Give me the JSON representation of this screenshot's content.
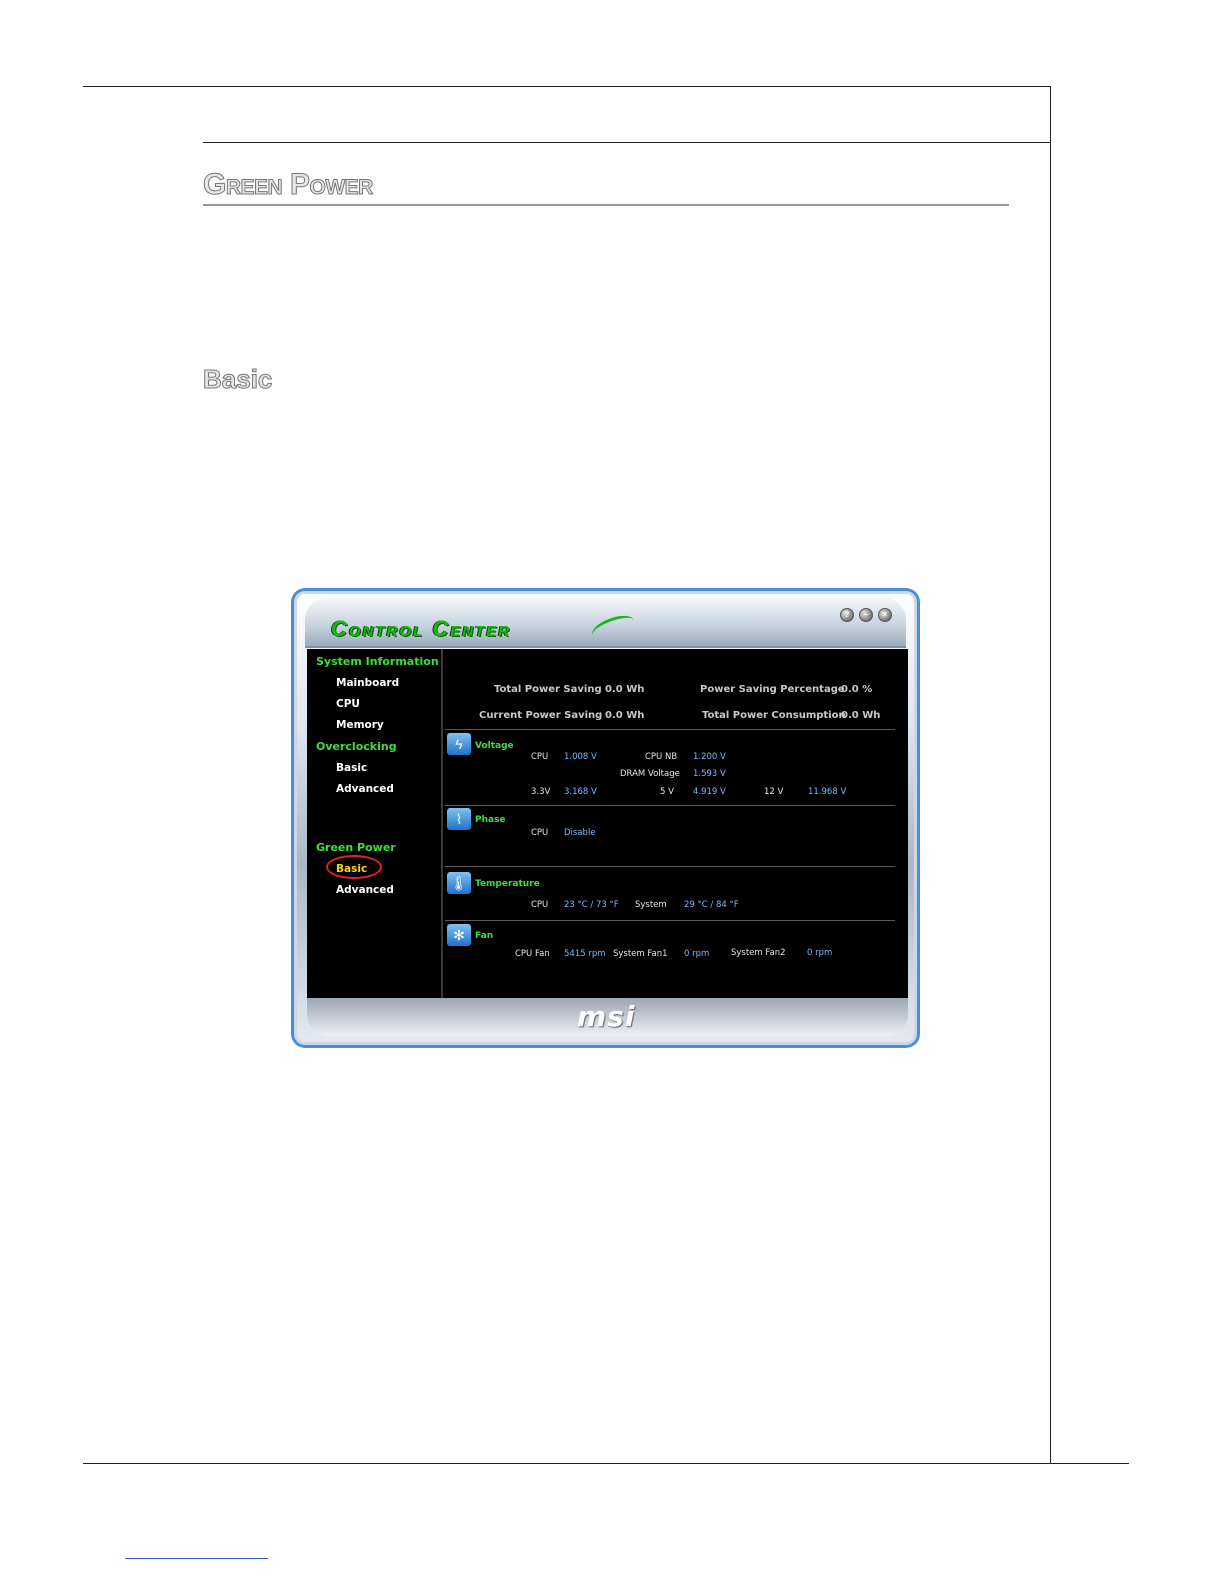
{
  "page": {
    "section_title": "Green Power",
    "sub_title": "Basic"
  },
  "app": {
    "logo": "Control Center",
    "brand": "msi",
    "window_buttons": [
      {
        "icon": "help-icon",
        "glyph": "?"
      },
      {
        "icon": "minimize-icon",
        "glyph": "–"
      },
      {
        "icon": "close-icon",
        "glyph": "×"
      }
    ],
    "sidebar": {
      "system_information": "System Information",
      "mainboard": "Mainboard",
      "cpu": "CPU",
      "memory": "Memory",
      "overclocking": "Overclocking",
      "oc_basic": "Basic",
      "oc_advanced": "Advanced",
      "green_power": "Green Power",
      "gp_basic": "Basic",
      "gp_advanced": "Advanced"
    },
    "summary": {
      "total_power_saving_label": "Total Power Saving",
      "total_power_saving_value": "0.0 Wh",
      "current_power_saving_label": "Current Power Saving",
      "current_power_saving_value": "0.0 Wh",
      "power_saving_percentage_label": "Power Saving Percentage",
      "power_saving_percentage_value": "0.0 %",
      "total_power_consumption_label": "Total Power Consumption",
      "total_power_consumption_value": "0.0 Wh"
    },
    "voltage": {
      "title": "Voltage",
      "cpu_label": "CPU",
      "cpu_value": "1.008 V",
      "cpunb_label": "CPU NB",
      "cpunb_value": "1.200 V",
      "dram_label": "DRAM Voltage",
      "dram_value": "1.593 V",
      "v33_label": "3.3V",
      "v33_value": "3.168 V",
      "v5_label": "5 V",
      "v5_value": "4.919 V",
      "v12_label": "12 V",
      "v12_value": "11.968 V"
    },
    "phase": {
      "title": "Phase",
      "cpu_label": "CPU",
      "cpu_value": "Disable"
    },
    "temperature": {
      "title": "Temperature",
      "cpu_label": "CPU",
      "cpu_value": "23 °C / 73 °F",
      "system_label": "System",
      "system_value": "29 °C / 84 °F"
    },
    "fan": {
      "title": "Fan",
      "cpu_fan_label": "CPU Fan",
      "cpu_fan_value": "5415 rpm",
      "sys_fan1_label": "System Fan1",
      "sys_fan1_value": "0 rpm",
      "sys_fan2_label": "System Fan2",
      "sys_fan2_value": "0 rpm"
    }
  }
}
